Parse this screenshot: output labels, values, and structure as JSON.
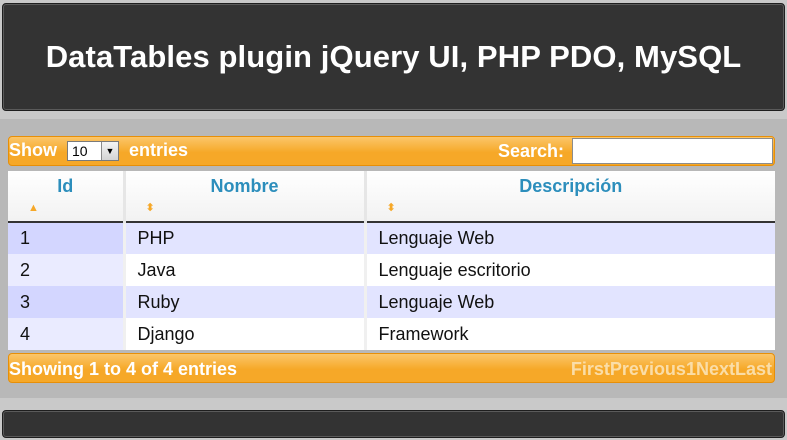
{
  "header": {
    "title": "DataTables plugin jQuery UI, PHP PDO, MySQL"
  },
  "toolbar": {
    "show_label": "Show",
    "page_length": "10",
    "entries_label": "entries",
    "search_label": "Search:",
    "search_value": ""
  },
  "table": {
    "columns": [
      "Id",
      "Nombre",
      "Descripción"
    ],
    "rows": [
      [
        "1",
        "PHP",
        "Lenguaje Web"
      ],
      [
        "2",
        "Java",
        "Lenguaje escritorio"
      ],
      [
        "3",
        "Ruby",
        "Lenguaje Web"
      ],
      [
        "4",
        "Django",
        "Framework"
      ]
    ]
  },
  "footer_bar": {
    "info": "Showing 1 to 4 of 4 entries",
    "paginate": {
      "first": "First",
      "previous": "Previous",
      "page": "1",
      "next": "Next",
      "last": "Last"
    }
  },
  "icons": {
    "sort_asc": "sort-asc-icon",
    "sort_both": "sort-both-icon",
    "select_arrow": "chevron-down-icon"
  },
  "colors": {
    "accent": "#f6a828",
    "header_text": "#2c8ebc",
    "row_odd": "#e2e4ff",
    "dark_bar": "#333333"
  }
}
